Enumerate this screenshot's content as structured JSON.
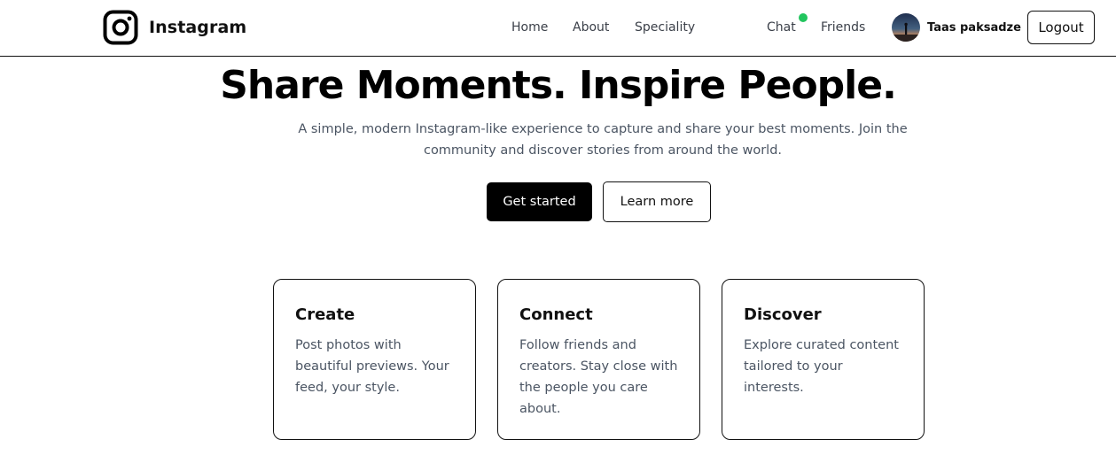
{
  "header": {
    "brand_name": "Instagram",
    "nav": {
      "home": "Home",
      "about": "About",
      "speciality": "Speciality",
      "chat": "Chat",
      "friends": "Friends"
    },
    "user_name": "Taas paksadze",
    "logout_label": "Logout",
    "online_status_color": "#22c55e"
  },
  "hero": {
    "title": "Share Moments. Inspire People.",
    "subtitle": "A simple, modern Instagram-like experience to capture and share your best moments. Join the community and discover stories from around the world.",
    "primary_cta": "Get started",
    "secondary_cta": "Learn more"
  },
  "features": [
    {
      "title": "Create",
      "description": "Post photos with beautiful previews. Your feed, your style."
    },
    {
      "title": "Connect",
      "description": "Follow friends and creators. Stay close with the people you care about."
    },
    {
      "title": "Discover",
      "description": "Explore curated content tailored to your interests."
    }
  ]
}
